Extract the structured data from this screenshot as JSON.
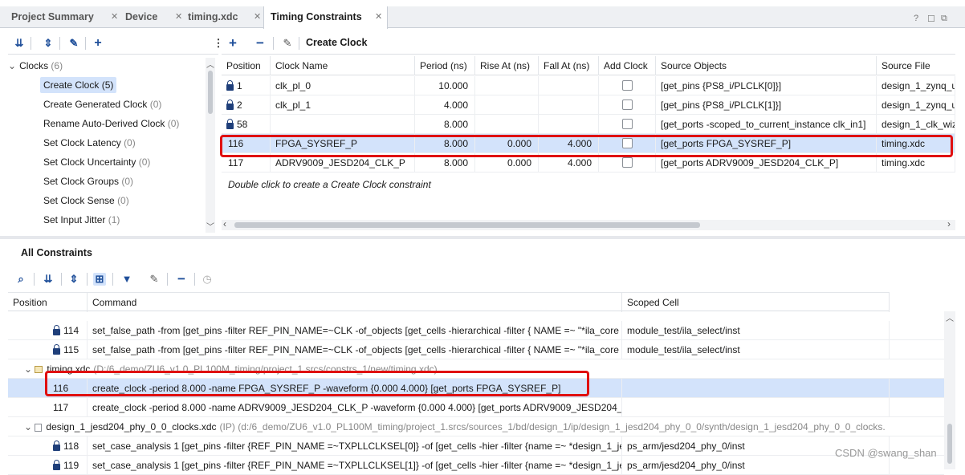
{
  "tabs": [
    {
      "label": "Project Summary"
    },
    {
      "label": "Device"
    },
    {
      "label": "timing.xdc"
    },
    {
      "label": "Timing Constraints"
    }
  ],
  "window_controls": {
    "help": "?",
    "restore": "☐",
    "maximize": "⧉"
  },
  "top_toolbar": {
    "title": "Create Clock"
  },
  "tree": {
    "root_label": "Clocks",
    "root_count": "(6)",
    "items": [
      {
        "label": "Create Clock",
        "count": "(5)"
      },
      {
        "label": "Create Generated Clock",
        "count": "(0)"
      },
      {
        "label": "Rename Auto-Derived Clock",
        "count": "(0)"
      },
      {
        "label": "Set Clock Latency",
        "count": "(0)"
      },
      {
        "label": "Set Clock Uncertainty",
        "count": "(0)"
      },
      {
        "label": "Set Clock Groups",
        "count": "(0)"
      },
      {
        "label": "Set Clock Sense",
        "count": "(0)"
      },
      {
        "label": "Set Input Jitter",
        "count": "(1)"
      }
    ]
  },
  "clock_table": {
    "headers": [
      "Position",
      "Clock Name",
      "Period (ns)",
      "Rise At (ns)",
      "Fall At (ns)",
      "Add Clock",
      "Source Objects",
      "Source File"
    ],
    "rows": [
      {
        "position": "1",
        "locked": true,
        "name": "clk_pl_0",
        "period": "10.000",
        "rise": "",
        "fall": "",
        "source": "[get_pins {PS8_i/PLCLK[0]}]",
        "file": "design_1_zynq_u"
      },
      {
        "position": "2",
        "locked": true,
        "name": "clk_pl_1",
        "period": "4.000",
        "rise": "",
        "fall": "",
        "source": "[get_pins {PS8_i/PLCLK[1]}]",
        "file": "design_1_zynq_u"
      },
      {
        "position": "58",
        "locked": true,
        "name": "",
        "period": "8.000",
        "rise": "",
        "fall": "",
        "source": "[get_ports -scoped_to_current_instance clk_in1]",
        "file": "design_1_clk_wiz"
      },
      {
        "position": "116",
        "locked": false,
        "name": "FPGA_SYSREF_P",
        "period": "8.000",
        "rise": "0.000",
        "fall": "4.000",
        "source": "[get_ports FPGA_SYSREF_P]",
        "file": "timing.xdc"
      },
      {
        "position": "117",
        "locked": false,
        "name": "ADRV9009_JESD204_CLK_P",
        "period": "8.000",
        "rise": "0.000",
        "fall": "4.000",
        "source": "[get_ports ADRV9009_JESD204_CLK_P]",
        "file": "timing.xdc"
      }
    ],
    "hint": "Double click to create a Create Clock constraint"
  },
  "all_constraints": {
    "title": "All Constraints",
    "headers": [
      "Position",
      "Command",
      "Scoped Cell"
    ],
    "rows": [
      {
        "kind": "locked",
        "position": "114",
        "command": "set_false_path -from [get_pins -filter REF_PIN_NAME=~CLK -of_objects [get_cells -hierarchical -filter { NAME =~  \"*ila_core",
        "cell": "module_test/ila_select/inst"
      },
      {
        "kind": "locked",
        "position": "115",
        "command": "set_false_path -from [get_pins -filter REF_PIN_NAME=~CLK -of_objects [get_cells -hierarchical -filter { NAME =~  \"*ila_core",
        "cell": "module_test/ila_select/inst"
      },
      {
        "kind": "group",
        "name": "timing.xdc",
        "path": "(D:/6_demo/ZU6_v1.0_PL100M_timing/project_1.srcs/constrs_1/new/timing.xdc)"
      },
      {
        "kind": "plain",
        "position": "116",
        "command": "create_clock -period 8.000 -name FPGA_SYSREF_P -waveform {0.000 4.000} [get_ports FPGA_SYSREF_P]",
        "cell": ""
      },
      {
        "kind": "plain",
        "position": "117",
        "command": "create_clock -period 8.000 -name ADRV9009_JESD204_CLK_P -waveform {0.000 4.000} [get_ports ADRV9009_JESD204_",
        "cell": ""
      },
      {
        "kind": "group2",
        "name": "design_1_jesd204_phy_0_0_clocks.xdc",
        "path": "(IP) (d:/6_demo/ZU6_v1.0_PL100M_timing/project_1.srcs/sources_1/bd/design_1/ip/design_1_jesd204_phy_0_0/synth/design_1_jesd204_phy_0_0_clocks."
      },
      {
        "kind": "locked",
        "position": "118",
        "command": "set_case_analysis 1 [get_pins -filter {REF_PIN_NAME =~TXPLLCLKSEL[0]} -of [get_cells -hier -filter {name =~ *design_1_je",
        "cell": "ps_arm/jesd204_phy_0/inst"
      },
      {
        "kind": "locked",
        "position": "119",
        "command": "set_case_analysis 1 [get_pins -filter {REF_PIN_NAME =~TXPLLCLKSEL[1]} -of [get_cells -hier -filter {name =~ *design_1_je",
        "cell": "ps_arm/jesd204_phy_0/inst"
      }
    ]
  },
  "watermark": "CSDN @swang_shan"
}
